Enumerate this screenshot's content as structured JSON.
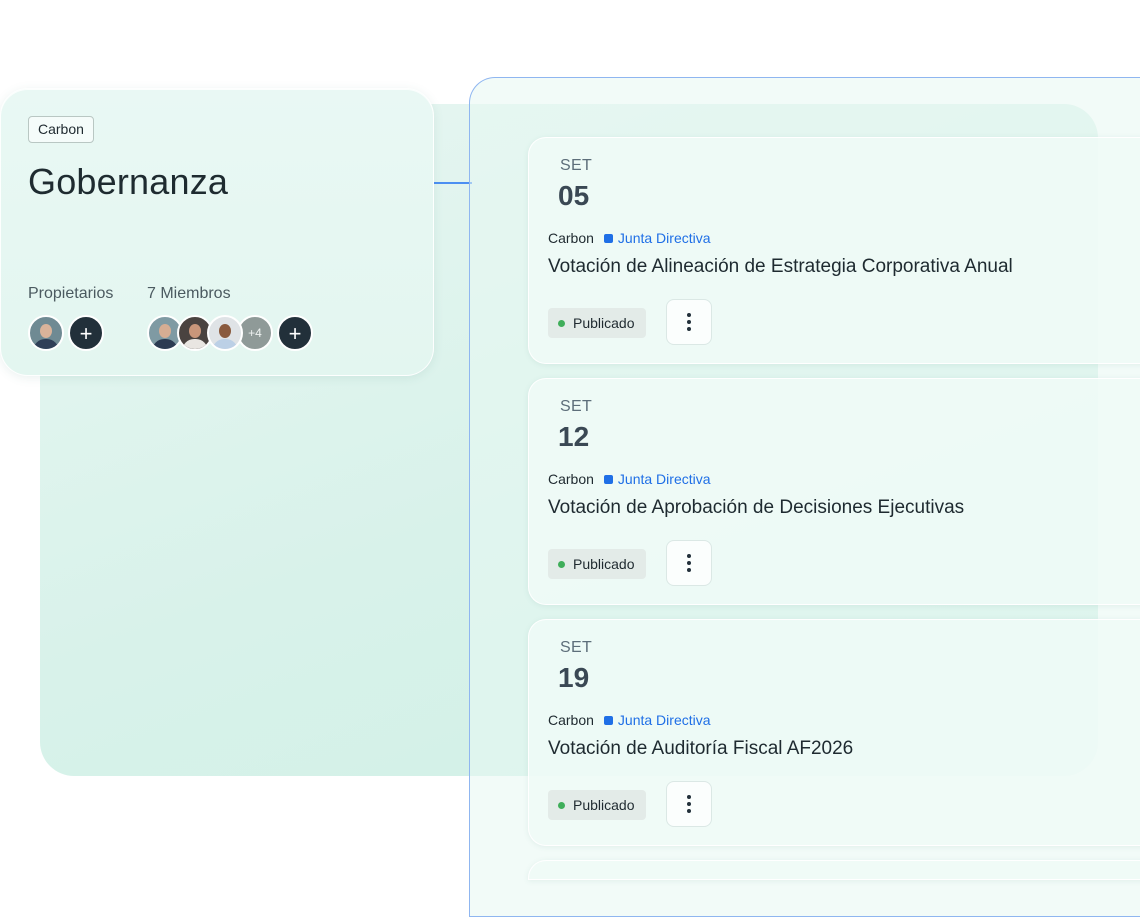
{
  "group": {
    "tag": "Carbon",
    "title": "Gobernanza",
    "owners_label": "Propietarios",
    "members_label": "7 Miembros",
    "members_more": "+4",
    "add_symbol": "+"
  },
  "events": [
    {
      "month": "SET",
      "day": "05",
      "org": "Carbon",
      "category": "Junta Directiva",
      "title": "Votación de Alineación de Estrategia Corporativa Anual",
      "status": "Publicado"
    },
    {
      "month": "SET",
      "day": "12",
      "org": "Carbon",
      "category": "Junta Directiva",
      "title": "Votación de Aprobación de Decisiones Ejecutivas",
      "status": "Publicado"
    },
    {
      "month": "SET",
      "day": "19",
      "org": "Carbon",
      "category": "Junta Directiva",
      "title": "Votación de Auditoría Fiscal AF2026",
      "status": "Publicado"
    }
  ],
  "colors": {
    "accent": "#1f6fe6",
    "status_published": "#3fae5a",
    "dark_button": "#22303a"
  },
  "icons": {
    "add": "plus-icon",
    "menu": "more-vertical-icon"
  }
}
